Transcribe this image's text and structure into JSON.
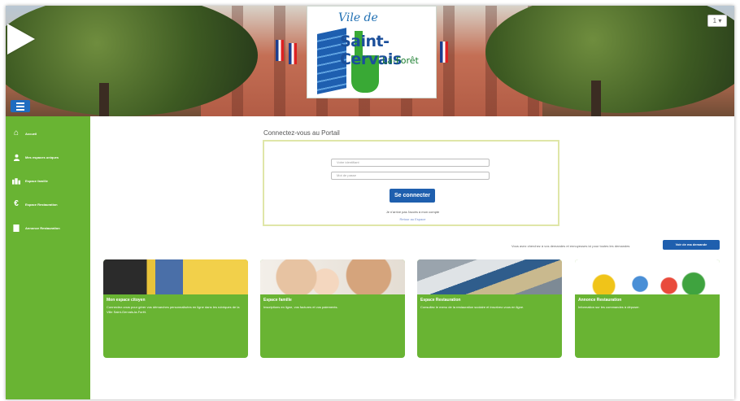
{
  "header": {
    "logo": {
      "line1": "Vile de",
      "line2": "Saint-Cervais",
      "line3": "La-Forêt"
    },
    "user_menu_label": "1 ▾",
    "icons": {
      "play": "play-icon",
      "menu": "hamburger-menu-icon"
    }
  },
  "sidebar": {
    "items": [
      {
        "icon": "home-icon",
        "label": "Accueil"
      },
      {
        "icon": "user-icon",
        "label": "Mes espaces uniques"
      },
      {
        "icon": "family-icon",
        "label": "Espace famille"
      },
      {
        "icon": "euro-icon",
        "label": "Espace Restauration"
      },
      {
        "icon": "document-icon",
        "label": "Annonce Restauration"
      }
    ]
  },
  "login": {
    "title": "Connectez-vous au Portail",
    "login_placeholder": "Votre identifiant",
    "password_placeholder": "Mot de passe",
    "submit_label": "Se connecter",
    "note": "Je n'arrive pas l'accès à mon compte",
    "link": "Retour au Espace"
  },
  "requests": {
    "text": "Vous avez cherchez à vos demandes et ennuyeuses ici pour toutes les demandes",
    "button_label": "Voir de ma demande"
  },
  "cards": [
    {
      "title": "Mon espace citoyen",
      "desc": "Connectez-vous pour gérer vos démarches personnalisées en ligne dans les rubriques de la Ville Saint-Gervais-la-Forêt."
    },
    {
      "title": "Espace famille",
      "desc": "Inscriptions en ligne, vos factures et vos paiements."
    },
    {
      "title": "Espace Restauration",
      "desc": "Consultez le menu de la restauration scolaire et inscrivez-vous en ligne."
    },
    {
      "title": "Annonce Restauration",
      "desc": "Information sur les commandes à déposer."
    }
  ],
  "colors": {
    "green": "#69b433",
    "blue": "#1f5fae",
    "login_border": "#dfe6a8"
  }
}
